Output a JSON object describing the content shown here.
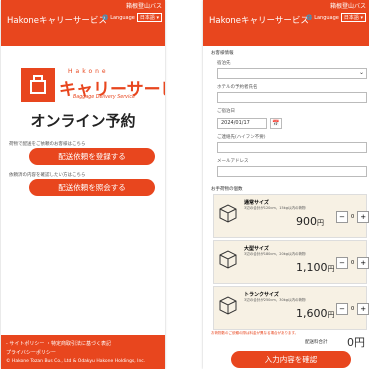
{
  "colors": {
    "brand": "#e8461e",
    "footer_text": "#ffffff",
    "card_bg": "#f7f1e4"
  },
  "left": {
    "header": {
      "title": "Hakoneキャリーサービス",
      "mountain": "箱根登山バス",
      "lang_label": "Language",
      "lang_value": "日本語"
    },
    "logo": {
      "brand": "Hakone",
      "main": "キャリーサービス",
      "sub": "Baggage Delivery Service"
    },
    "headline": "オンライン予約",
    "hint_register": "荷物で配送をご依頼のお客様はこちら",
    "button_register": "配送依頼を登録する",
    "hint_confirm": "依頼済の内容を確認したい方はこちら",
    "button_confirm": "配送依頼を照会する",
    "footer": {
      "line1": "- サイトポリシー ・特定商取引法に基づく表記",
      "line2": "プライバシーポリシー",
      "line3": "© Hakone Tozan Bus Co., Ltd & Odakyu Hakone Holdings, Inc."
    }
  },
  "right": {
    "header": {
      "title": "Hakoneキャリーサービス",
      "mountain": "箱根登山バス",
      "lang_label": "Language",
      "lang_value": "日本語"
    },
    "section_customer": "お客様情報",
    "labels": {
      "hotel": "宿泊先",
      "name": "ホテルの予約者氏名",
      "date": "ご宿泊日",
      "phone": "ご連絡先(ハイフン不要)",
      "email": "メールアドレス"
    },
    "date_value": "2024/01/17",
    "section_count": "お手荷物の個数",
    "cards": [
      {
        "name": "通常サイズ",
        "spec": "3辺の合計が120cm、15kg以内の荷物",
        "price": "900",
        "qty": "0"
      },
      {
        "name": "大型サイズ",
        "spec": "3辺の合計が180cm、20kg以内の荷物",
        "price": "1,100",
        "qty": "0"
      },
      {
        "name": "トランクサイズ",
        "spec": "3辺の合計が250cm、30kg以内の荷物",
        "price": "1,600",
        "qty": "0"
      }
    ],
    "yen": "円",
    "note": "お荷物数のご依頼の際は料金が異なる場合があります。",
    "total_label": "配送料合計",
    "total_value": "0円",
    "confirm_button": "入力内容を確認"
  }
}
